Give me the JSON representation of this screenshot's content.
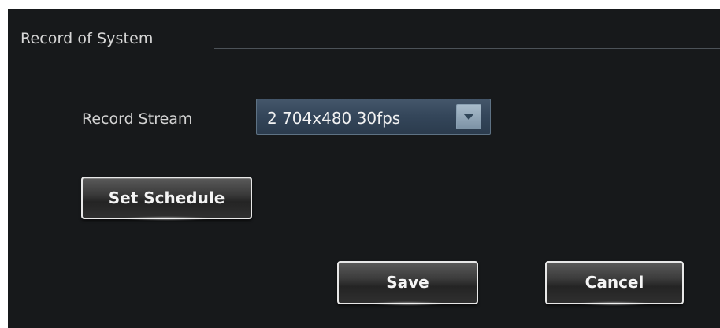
{
  "group": {
    "title": "Record of System"
  },
  "record_stream": {
    "label": "Record Stream",
    "selected": "2 704x480 30fps",
    "arrow_icon": "chevron-down-icon"
  },
  "buttons": {
    "set_schedule": "Set Schedule",
    "save": "Save",
    "cancel": "Cancel"
  },
  "colors": {
    "panel_background": "#17191b",
    "select_background": "#3a4c60",
    "text": "#d6d6d6"
  }
}
